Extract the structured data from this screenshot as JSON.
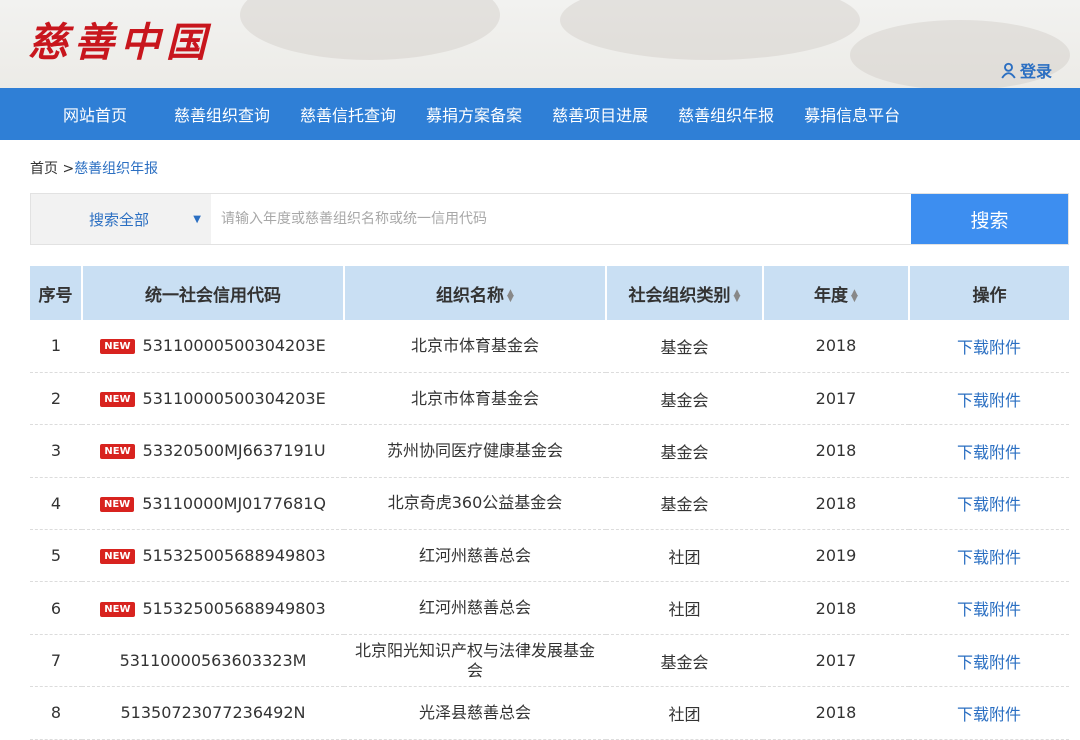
{
  "header": {
    "logo": "慈善中国",
    "login_label": "登录"
  },
  "nav": {
    "items": [
      "网站首页",
      "慈善组织查询",
      "慈善信托查询",
      "募捐方案备案",
      "慈善项目进展",
      "慈善组织年报",
      "募捐信息平台"
    ]
  },
  "breadcrumb": {
    "home": "首页",
    "separator": ">",
    "current": "慈善组织年报"
  },
  "search": {
    "select_value": "搜索全部",
    "placeholder": "请输入年度或慈善组织名称或统一信用代码",
    "button_label": "搜索"
  },
  "table": {
    "columns": [
      "序号",
      "统一社会信用代码",
      "组织名称",
      "社会组织类别",
      "年度",
      "操作"
    ],
    "badge_label": "NEW",
    "rows": [
      {
        "index": "1",
        "new": true,
        "code": "53110000500304203E",
        "name": "北京市体育基金会",
        "category": "基金会",
        "year": "2018",
        "action": "下载附件"
      },
      {
        "index": "2",
        "new": true,
        "code": "53110000500304203E",
        "name": "北京市体育基金会",
        "category": "基金会",
        "year": "2017",
        "action": "下载附件"
      },
      {
        "index": "3",
        "new": true,
        "code": "53320500MJ6637191U",
        "name": "苏州协同医疗健康基金会",
        "category": "基金会",
        "year": "2018",
        "action": "下载附件"
      },
      {
        "index": "4",
        "new": true,
        "code": "53110000MJ0177681Q",
        "name": "北京奇虎360公益基金会",
        "category": "基金会",
        "year": "2018",
        "action": "下载附件"
      },
      {
        "index": "5",
        "new": true,
        "code": "515325005688949803",
        "name": "红河州慈善总会",
        "category": "社团",
        "year": "2019",
        "action": "下载附件"
      },
      {
        "index": "6",
        "new": true,
        "code": "515325005688949803",
        "name": "红河州慈善总会",
        "category": "社团",
        "year": "2018",
        "action": "下载附件"
      },
      {
        "index": "7",
        "new": false,
        "code": "53110000563603323M",
        "name": "北京阳光知识产权与法律发展基金会",
        "category": "基金会",
        "year": "2017",
        "action": "下载附件"
      },
      {
        "index": "8",
        "new": false,
        "code": "51350723077236492N",
        "name": "光泽县慈善总会",
        "category": "社团",
        "year": "2018",
        "action": "下载附件"
      }
    ]
  },
  "colors": {
    "nav_bg": "#2f7fd6",
    "logo_red": "#c8161d",
    "link_blue": "#2b6fc2",
    "header_row_bg": "#c9dff3",
    "badge_red": "#d8231f",
    "search_button": "#3d8ef0"
  },
  "icons": {
    "login": "user-icon",
    "select": "caret-down-icon",
    "sort": "sort-arrows-icon"
  }
}
